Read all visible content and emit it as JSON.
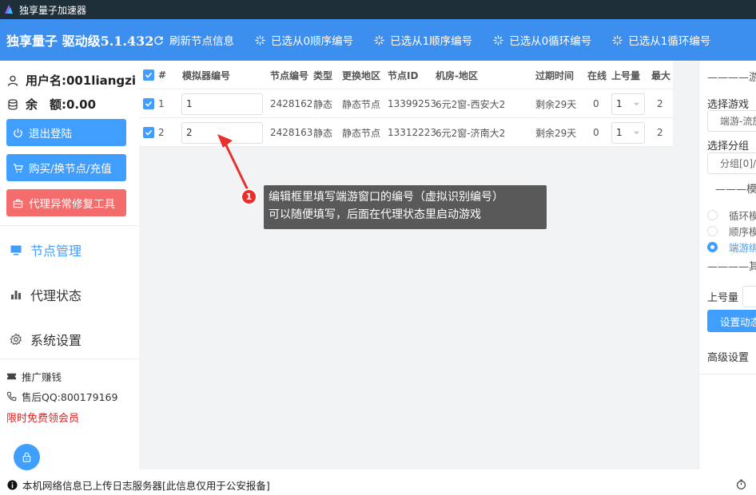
{
  "window": {
    "title": "独享量子加速器"
  },
  "header": {
    "brand": "独享量子 驱动级5.1.432",
    "buttons": [
      {
        "label": "刷新节点信息",
        "icon": "refresh-icon"
      },
      {
        "label": "已选从0顺序编号",
        "icon": "sparkle-icon"
      },
      {
        "label": "已选从1顺序编号",
        "icon": "sparkle-icon"
      },
      {
        "label": "已选从0循环编号",
        "icon": "sparkle-icon"
      },
      {
        "label": "已选从1循环编号",
        "icon": "sparkle-icon"
      }
    ]
  },
  "sidebar": {
    "username": "用户名:001liangzi",
    "balance": "余　额:0.00",
    "logout": "退出登陆",
    "buy": "购买/换节点/充值",
    "repair": "代理异常修复工具",
    "nav": [
      {
        "label": "节点管理",
        "icon": "monitor-icon"
      },
      {
        "label": "代理状态",
        "icon": "bar-chart-icon"
      },
      {
        "label": "系统设置",
        "icon": "gear-icon"
      }
    ],
    "promote": "推广赚钱",
    "support": "售后QQ:800179169",
    "promo": "限时免费领会员"
  },
  "table": {
    "headers": [
      "#",
      "模拟器编号",
      "节点编号",
      "类型",
      "更换地区",
      "节点ID",
      "机房-地区",
      "过期时间",
      "在线",
      "上号量",
      "最大"
    ],
    "rows": [
      {
        "index": "1",
        "emulator": "1",
        "node_no": "2428162",
        "type": "静态",
        "region": "静态节点",
        "node_id": "13399253",
        "room": "6元2窗-西安大2",
        "expire": "剩余29天",
        "online": "0",
        "login": "1",
        "max": "2"
      },
      {
        "index": "2",
        "emulator": "2",
        "node_no": "2428163",
        "type": "静态",
        "region": "静态节点",
        "node_id": "13312223",
        "room": "6元2窗-济南大2",
        "expire": "剩余29天",
        "online": "0",
        "login": "1",
        "max": "2"
      }
    ]
  },
  "annotation": {
    "badge": "1",
    "line1": "编辑框里填写端游窗口的编号（虚拟识别编号）",
    "line2": "可以随便填写，后面在代理状态里启动游戏"
  },
  "right_panel": {
    "section_game": "————游",
    "select_game_label": "选择游戏",
    "select_game_value": "端游-流放",
    "select_group_label": "选择分组",
    "select_group_value": "分组[0]/",
    "section_mode": "———模式",
    "radios": [
      {
        "label": "循环模",
        "checked": false
      },
      {
        "label": "顺序模",
        "checked": false
      },
      {
        "label": "端游绑",
        "checked": true
      }
    ],
    "section_other": "————其",
    "login_label": "上号量",
    "set_button": "设置动态",
    "advanced": "高级设置"
  },
  "status": {
    "text": "本机网络信息已上传日志服务器[此信息仅用于公安报备]"
  },
  "colors": {
    "accent": "#409eff",
    "header": "#3d8fef",
    "danger": "#f56c6c",
    "titlebar": "#1f2f3a"
  }
}
